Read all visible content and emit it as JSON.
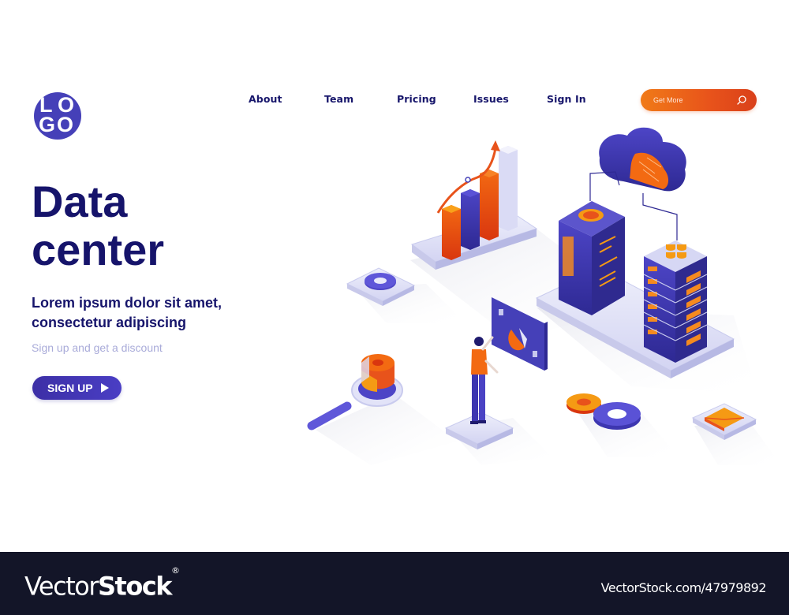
{
  "logo": {
    "letters": [
      "L",
      "O",
      "G",
      "O"
    ],
    "color": "#4540b8"
  },
  "nav": {
    "items": [
      {
        "label": "About"
      },
      {
        "label": "Team"
      },
      {
        "label": "Pricing"
      },
      {
        "label": "Issues"
      },
      {
        "label": "Sign In"
      }
    ]
  },
  "search": {
    "placeholder": "Get More",
    "value": "",
    "icon": "search-icon"
  },
  "hero": {
    "title_line1": "Data",
    "title_line2": "center",
    "subtitle_line1": "Lorem ipsum dolor sit amet,",
    "subtitle_line2": "consectetur adipiscing",
    "note": "Sign up and get a discount",
    "cta_label": "SIGN UP",
    "cta_icon": "play-icon"
  },
  "illustration": {
    "elements": [
      "bar-chart-growth",
      "cloud-circuit",
      "server-tower",
      "server-rack",
      "settings-gear-tile",
      "magnifier-pie-chart",
      "person-touch-screen",
      "gears-pair",
      "mail-envelope-tile"
    ]
  },
  "colors": {
    "navy_text": "#16146b",
    "accent_orange": "#e8531b",
    "accent_blue": "#4540b8",
    "muted_text": "#a9abd9",
    "footer_bg": "#131528"
  },
  "footer": {
    "brand_thin": "Vector",
    "brand_bold": "Stock",
    "brand_mark": "®",
    "image_id_text": "VectorStock.com/47979892"
  }
}
